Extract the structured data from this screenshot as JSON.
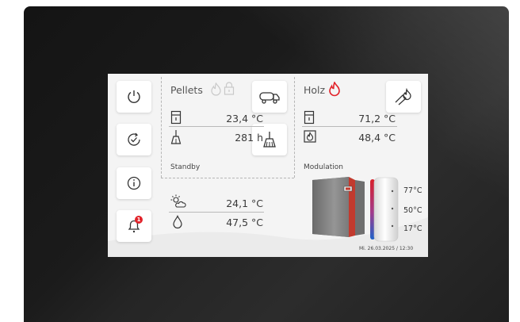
{
  "left_nav": [
    {
      "id": "power",
      "icon": "power-icon"
    },
    {
      "id": "refresh",
      "icon": "check-cycle-icon"
    },
    {
      "id": "info",
      "icon": "info-icon"
    },
    {
      "id": "alarm",
      "icon": "bell-icon",
      "badge": "1"
    }
  ],
  "pellets": {
    "title": "Pellets",
    "temp": "23,4 °C",
    "hours": "281 h",
    "status": "Standby",
    "icons": [
      "flame-outline-icon",
      "lock-icon",
      "truck-icon",
      "broom-icon",
      "boiler-icon"
    ]
  },
  "holz": {
    "title": "Holz",
    "boiler_temp": "71,2 °C",
    "flame_temp": "48,4 °C",
    "status": "Modulation",
    "flame_color": "#e2232a",
    "icons": [
      "flame-active-icon",
      "wood-ignition-icon",
      "boiler-icon",
      "flame-box-icon"
    ]
  },
  "outdoor": {
    "air_temp": "24,1 °C",
    "water_temp": "47,5 °C",
    "icons": [
      "sun-cloud-icon",
      "water-drop-icon"
    ]
  },
  "storage": {
    "top": "77°C",
    "mid": "50°C",
    "bottom": "17°C"
  },
  "datetime": "Mi. 26.03.2025 / 12:30",
  "colors": {
    "accent": "#e2232a",
    "hot": "#d8202a",
    "cold": "#1f63c9"
  }
}
